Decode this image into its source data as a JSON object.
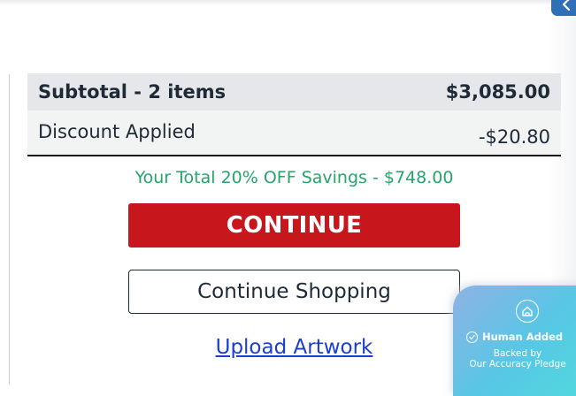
{
  "summary": {
    "subtotal_label": "Subtotal - 2 items",
    "subtotal_value": "$3,085.00",
    "discount_label": "Discount Applied",
    "discount_value": "-$20.80"
  },
  "savings_text": "Your Total 20% OFF Savings - $748.00",
  "actions": {
    "continue_label": "CONTINUE",
    "continue_shopping_label": "Continue Shopping",
    "upload_artwork_label": "Upload Artwork"
  },
  "badge": {
    "icon": "home-icon",
    "line1": "Human Added",
    "line2": "Backed by",
    "line3": "Our Accuracy Pledge"
  },
  "icons": {
    "collapse": "chevron-left-icon",
    "check": "check-circle-icon"
  },
  "colors": {
    "continue_button": "#c8161d",
    "savings_text": "#25a56a",
    "link": "#1a3ecf",
    "tab": "#2f6fb8",
    "badge_gradient_start": "#8fb2e4",
    "badge_gradient_end": "#52d8dd"
  }
}
